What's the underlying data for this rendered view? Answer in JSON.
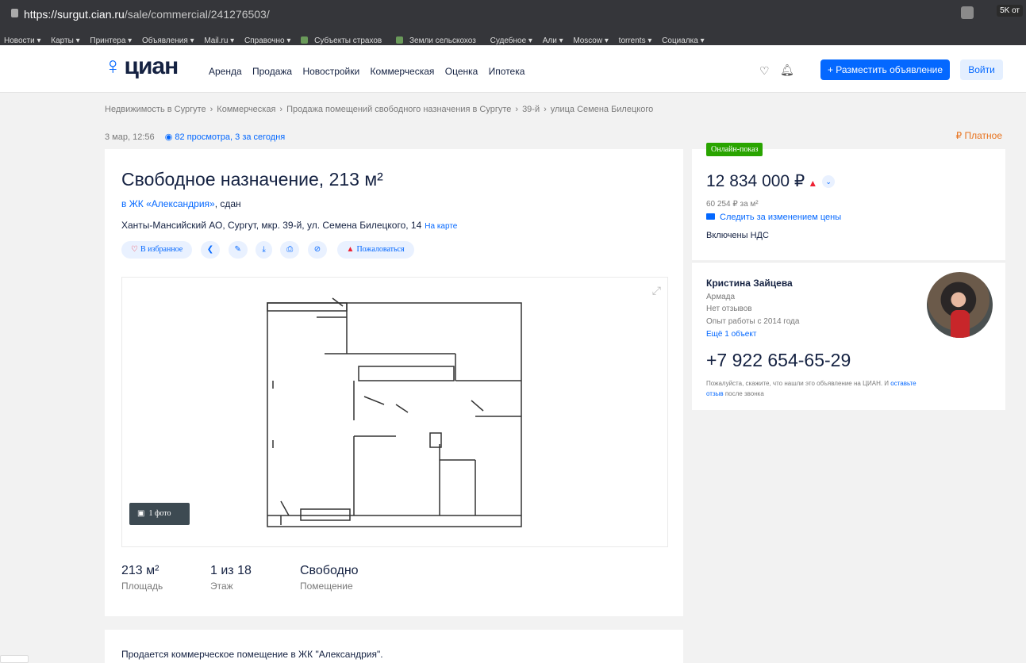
{
  "browser": {
    "url_host": "https://surgut.cian.ru",
    "url_path": "/sale/commercial/241276503/",
    "ext_badge": "5K от",
    "bookmarks": [
      "Новости ▾",
      "Карты ▾",
      "Принтера ▾",
      "Объявления ▾",
      "Mail.ru ▾",
      "Справочно ▾",
      "Субъекты страхов",
      "Земли сельскохоз",
      "Судебное ▾",
      "Али ▾",
      "Moscow ▾",
      "torrents ▾",
      "Социалка ▾"
    ]
  },
  "header": {
    "logo": "циан",
    "nav": [
      "Аренда",
      "Продажа",
      "Новостройки",
      "Коммерческая",
      "Оценка",
      "Ипотека"
    ],
    "post_button": "+ Разместить объявление",
    "login_button": "Войти"
  },
  "breadcrumb": [
    "Недвижимость в Сургуте",
    "Коммерческая",
    "Продажа помещений свободного назначения в Сургуте",
    "39-й",
    "улица Семена Билецкого"
  ],
  "meta": {
    "date": "3 мар, 12:56",
    "views": "82 просмотра, 3 за сегодня",
    "paid": "Платное"
  },
  "listing": {
    "title": "Свободное назначение, 213 м²",
    "complex_link": "в ЖК «Александрия»",
    "complex_status": ", сдан",
    "address": "Ханты-Мансийский АО, Сургут, мкр. 39-й, ул. Семена Билецкого, 14",
    "map_link": "На карте",
    "favorite": "В избранное",
    "complain": "Пожаловаться",
    "photo_count": "1 фото",
    "stats": [
      {
        "value": "213 м²",
        "label": "Площадь"
      },
      {
        "value": "1 из 18",
        "label": "Этаж"
      },
      {
        "value": "Свободно",
        "label": "Помещение"
      }
    ],
    "description": "Продается коммерческое помещение в ЖК \"Александрия\"."
  },
  "price": {
    "badge": "Онлайн-показ",
    "amount": "12 834 000 ₽",
    "per_meter": "60 254 ₽ за м²",
    "follow": "Следить за изменением цены",
    "vat": "Включены НДС"
  },
  "agent": {
    "name": "Кристина Зайцева",
    "company": "Армада",
    "reviews": "Нет отзывов",
    "experience": "Опыт работы с 2014 года",
    "more": "Ещё 1 объект",
    "phone": "+7 922 654-65-29",
    "hint_before": "Пожалуйста, скажите, что нашли это объявление на ЦИАН. И ",
    "hint_link": "оставьте отзыв",
    "hint_after": " после звонка"
  },
  "icons": {
    "lock": "lock-icon",
    "heart": "heart-icon",
    "bell": "bell-icon",
    "share": "share-icon",
    "edit": "pencil-icon",
    "download": "download-icon",
    "print": "print-icon",
    "hide": "hide-icon",
    "warning": "warning-icon",
    "camera": "camera-icon",
    "expand": "expand-icon",
    "eye": "eye-icon",
    "ruble": "ruble-icon",
    "envelope": "envelope-icon"
  },
  "colors": {
    "accent": "#0468ff",
    "badge_green": "#29a400",
    "paid_orange": "#e8731e",
    "alert_red": "#e22233"
  }
}
